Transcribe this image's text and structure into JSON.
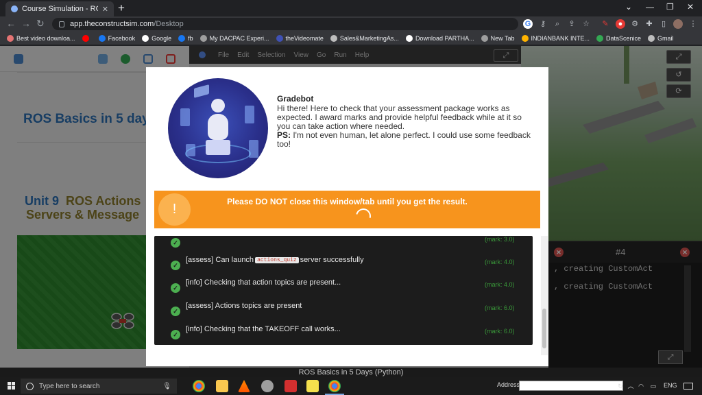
{
  "browser": {
    "tab_title": "Course Simulation - ROS Basics i",
    "new_tab_label": "+",
    "url_host": "app.theconstructsim.com",
    "url_path": "/Desktop",
    "bookmarks": [
      {
        "label": "Best video downloa...",
        "color": "#e57373"
      },
      {
        "label": "",
        "color": "#ff0000"
      },
      {
        "label": "Facebook",
        "color": "#1877f2"
      },
      {
        "label": "Google",
        "color": "#ffffff"
      },
      {
        "label": "fb",
        "color": "#1877f2"
      },
      {
        "label": "My DACPAC Experi...",
        "color": "#9e9e9e"
      },
      {
        "label": "theVideomate",
        "color": "#3f51b5"
      },
      {
        "label": "Sales&MarketingAs...",
        "color": "#bdbdbd"
      },
      {
        "label": "Download PARTHA...",
        "color": "#ffffff"
      },
      {
        "label": "New Tab",
        "color": "#9e9e9e"
      },
      {
        "label": "INDIANBANK INTE...",
        "color": "#ffb300"
      },
      {
        "label": "DataScenice",
        "color": "#34a853"
      },
      {
        "label": "Gmail",
        "color": "#bdbdbd"
      }
    ]
  },
  "course": {
    "title": "ROS Basics in 5 day",
    "unit_number": "Unit 9",
    "unit_name": "ROS Actions",
    "unit_sub": "Servers & Message",
    "footer": "ROS Basics in 5 Days (Python)"
  },
  "ide": {
    "menu": [
      "File",
      "Edit",
      "Selection",
      "View",
      "Go",
      "Run",
      "Help"
    ]
  },
  "terminal": {
    "tab_label": "#4",
    "lines": [
      ", creating CustomAct",
      ", creating CustomAct"
    ]
  },
  "gradebot": {
    "name": "Gradebot",
    "intro": "Hi there! Here to check that your assessment package works as expected. I award marks and provide helpful feedback while at it so you can take action where needed.",
    "ps_label": "PS:",
    "ps_text": " I'm not even human, let alone perfect. I could use some feedback too!",
    "warning_icon": "!",
    "warning": "Please DO NOT close this window/tab until you get the result.",
    "results": [
      {
        "prefix": "",
        "code": "",
        "suffix": "",
        "mark": "(mark: 3.0)"
      },
      {
        "prefix": "[assess] Can launch",
        "code": "actions_quiz",
        "suffix": "server successfully",
        "mark": "(mark: 4.0)"
      },
      {
        "prefix": "[info] Checking that action topics are present...",
        "code": "",
        "suffix": "",
        "mark": "(mark: 4.0)"
      },
      {
        "prefix": "[assess] Actions topics are present",
        "code": "",
        "suffix": "",
        "mark": "(mark: 6.0)"
      },
      {
        "prefix": "[info] Checking that the TAKEOFF call works...",
        "code": "",
        "suffix": "",
        "mark": "(mark: 6.0)"
      }
    ]
  },
  "taskbar": {
    "search_placeholder": "Type here to search",
    "address_label": "Address",
    "language": "ENG"
  },
  "colors": {
    "warning_orange": "#f7941d",
    "success_green": "#4caf50",
    "course_blue": "#2a6fb5"
  }
}
